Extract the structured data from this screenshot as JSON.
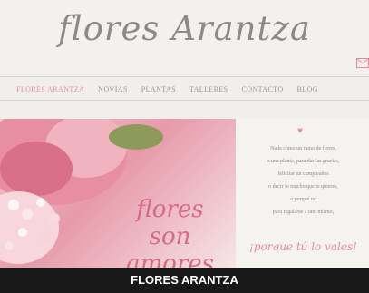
{
  "header": {
    "logo_text": "flores Arantza"
  },
  "nav": {
    "items": [
      {
        "label": "FLORES ARANTZA",
        "active": true
      },
      {
        "label": "NOVIAS"
      },
      {
        "label": "PLANTAS"
      },
      {
        "label": "TALLERES"
      },
      {
        "label": "CONTACTO"
      },
      {
        "label": "BLOG"
      }
    ]
  },
  "hero": {
    "title_line1": "flores",
    "title_line2": "son amores",
    "text_lines": [
      "Nada como un ramo de flores,",
      "o una planta, para dar las gracias,",
      "felicitar un cumpleaños",
      "o decir lo mucho que te quieres,",
      "o porqué no",
      "para regalarse a uno mismo,"
    ],
    "slogan": "¡porque tú lo vales!"
  },
  "caption": "FLORES ARANTZA",
  "colors": {
    "accent": "#e68aa0",
    "text": "#8f8a86",
    "bar": "#181818"
  },
  "icons": [
    "mail-icon",
    "heart-icon"
  ]
}
